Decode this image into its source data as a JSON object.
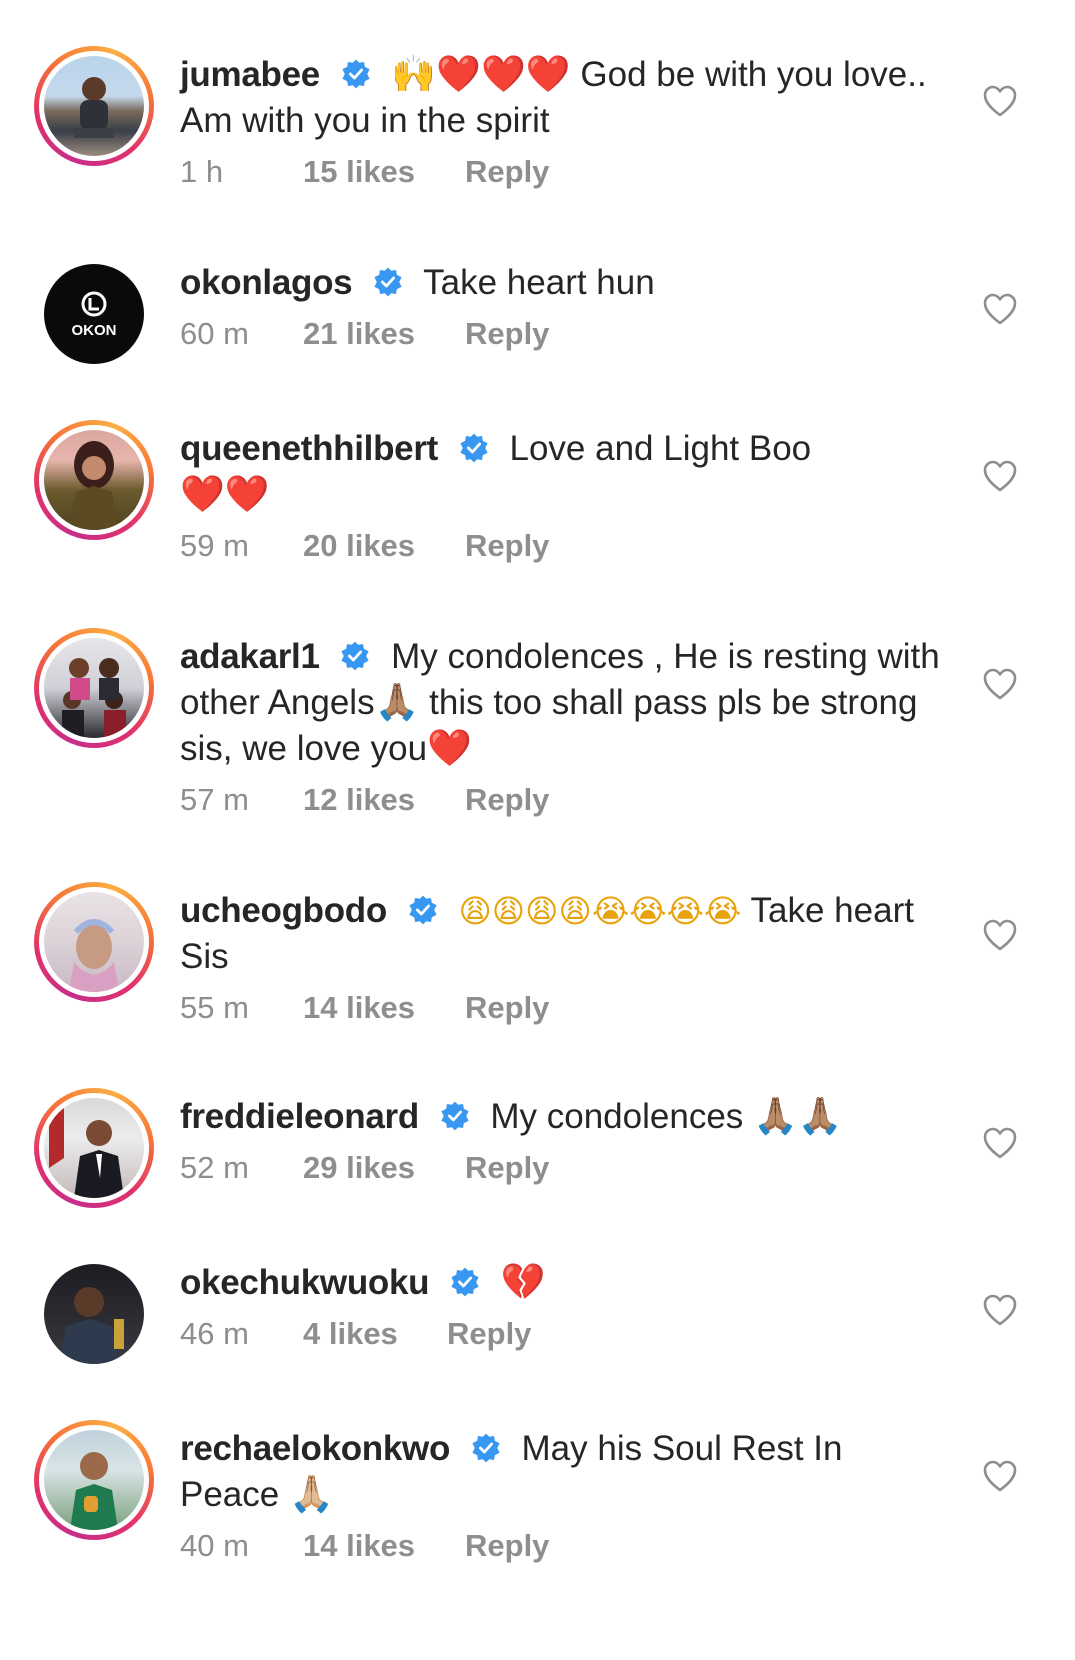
{
  "comments": [
    {
      "username": "jumabee",
      "text": "God be with you love.. Am with you in the spirit",
      "emojis": "🙌❤️❤️❤️",
      "time": "1 h",
      "likes": "15 likes",
      "reply": "Reply"
    },
    {
      "username": "okonlagos",
      "text": "Take heart hun",
      "time": "60 m",
      "likes": "21 likes",
      "reply": "Reply",
      "avatar_text": "OKON"
    },
    {
      "username": "queenethhilbert",
      "text": "Love and Light Boo",
      "emojis": "❤️❤️",
      "time": "59 m",
      "likes": "20 likes",
      "reply": "Reply"
    },
    {
      "username": "adakarl1",
      "text_a": "My condolences , He is resting with other Angels",
      "emoji_a": "🙏🏽",
      "text_b": " this too shall pass pls be strong sis, we love you",
      "emoji_b": "❤️",
      "time": "57 m",
      "likes": "12 likes",
      "reply": "Reply"
    },
    {
      "username": "ucheogbodo",
      "emojis": "😩😩😩😩😭😭😭😭",
      "text": " Take heart Sis",
      "time": "55 m",
      "likes": "14 likes",
      "reply": "Reply"
    },
    {
      "username": "freddieleonard",
      "text": "My condolences ",
      "emojis": "🙏🏽🙏🏽",
      "time": "52 m",
      "likes": "29 likes",
      "reply": "Reply"
    },
    {
      "username": "okechukwuoku",
      "emojis": "💔",
      "time": "46 m",
      "likes": "4 likes",
      "reply": "Reply"
    },
    {
      "username": "rechaelokonkwo",
      "text": "May his Soul Rest In Peace ",
      "emojis": "🙏🏼",
      "time": "40 m",
      "likes": "14 likes",
      "reply": "Reply"
    }
  ],
  "colors": {
    "text": "#262626",
    "meta": "#8e8e8e",
    "verified": "#3897f0",
    "heart": "#e0162b",
    "ring": "#e1306c"
  },
  "icons": {
    "verified": "verified-badge-icon",
    "like": "heart-outline-icon"
  }
}
